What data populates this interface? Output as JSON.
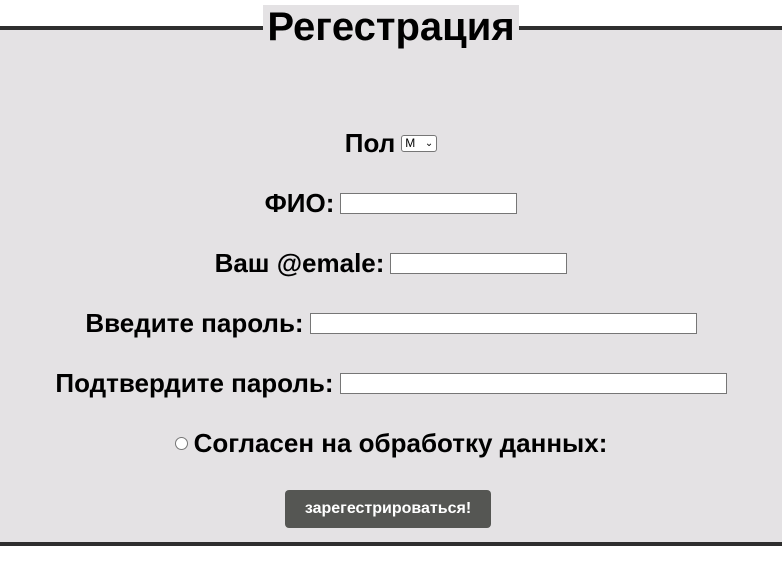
{
  "form": {
    "title": "Регестрация",
    "gender": {
      "label": "Пол",
      "selected": "М"
    },
    "fio": {
      "label": "ФИО:",
      "value": ""
    },
    "email": {
      "label": "Ваш @emale:",
      "value": ""
    },
    "password": {
      "label": "Введите пароль:",
      "value": ""
    },
    "confirm_password": {
      "label": "Подтвердите пароль:",
      "value": ""
    },
    "consent": {
      "label": "Согласен на обработку данных:",
      "checked": false
    },
    "submit_label": "зарегестрироваться!"
  },
  "colors": {
    "panel_background": "#e4e2e4",
    "border": "#2e2e2e",
    "button_background": "#555653",
    "button_text": "#ffffff"
  }
}
